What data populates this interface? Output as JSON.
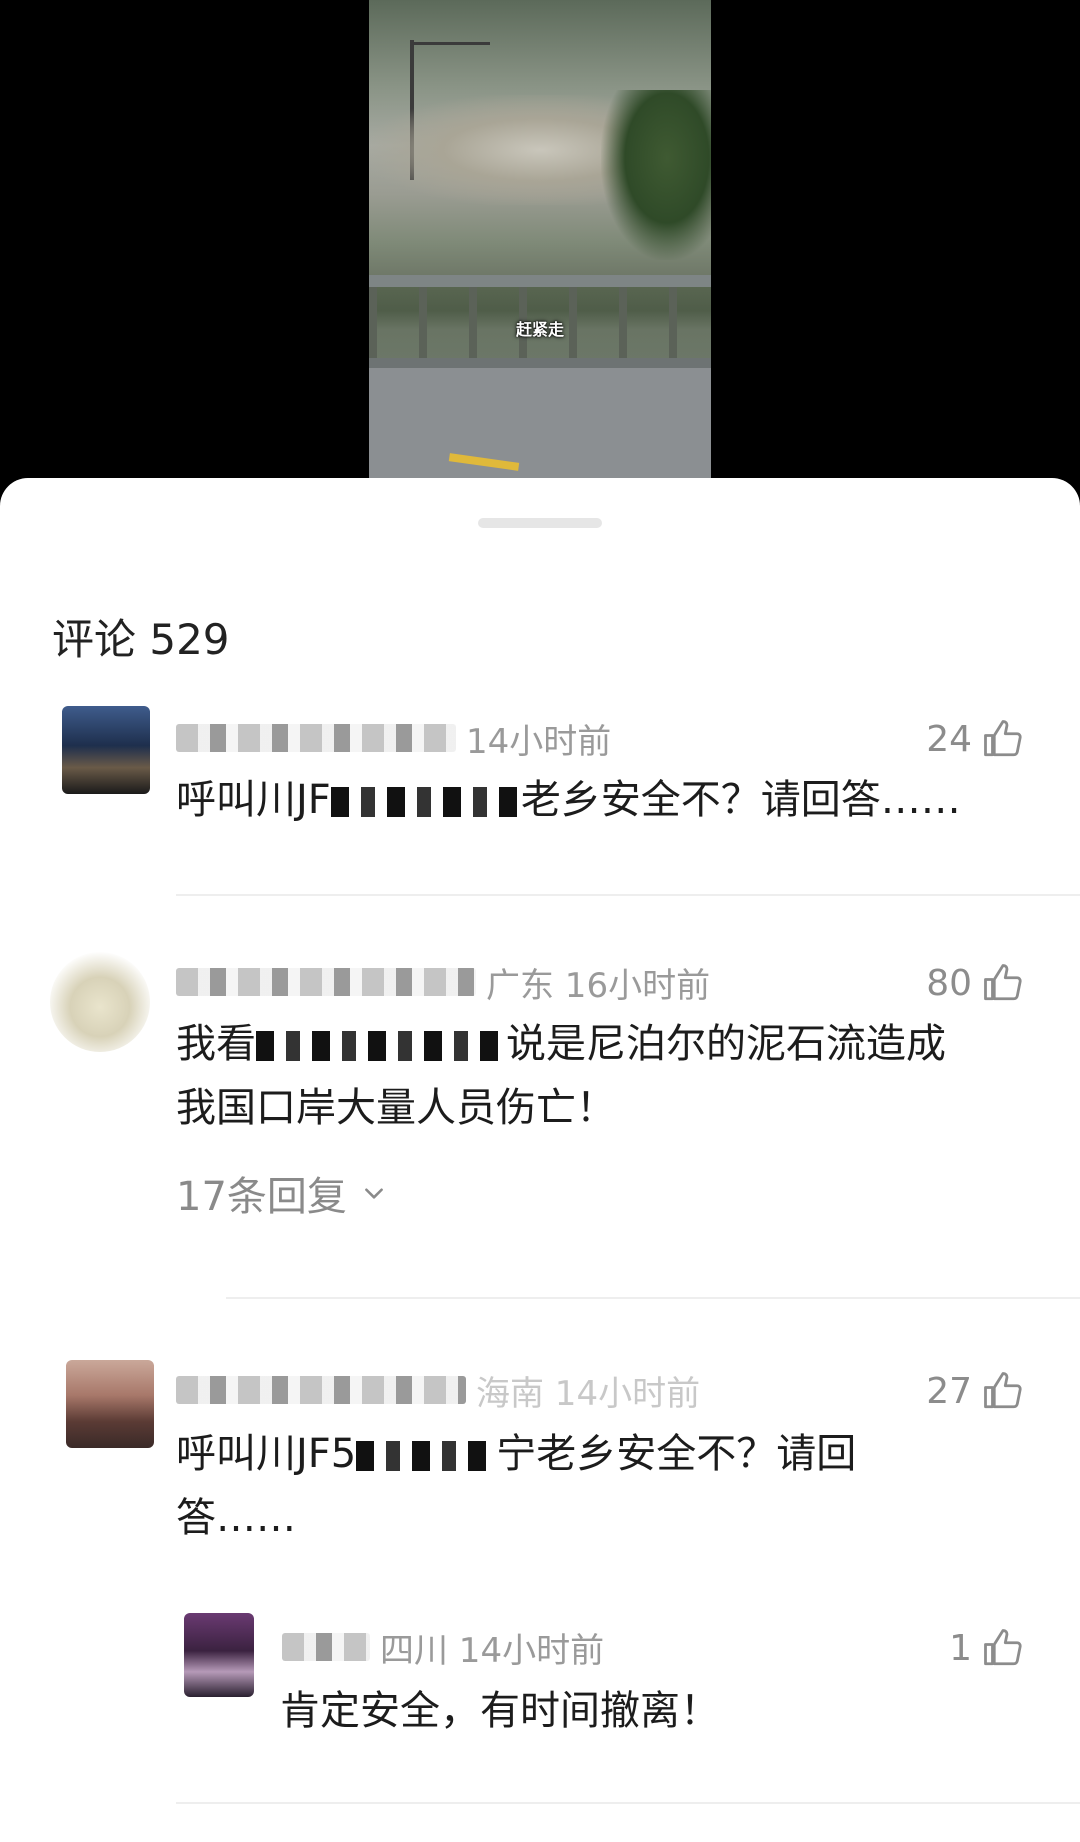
{
  "video": {
    "caption": "赶紧走"
  },
  "comments_header": {
    "title": "评论 529"
  },
  "comments": [
    {
      "meta": "14小时前",
      "likes": "24",
      "text_prefix": "呼叫川JF",
      "text_suffix": "老乡安全不？请回答……"
    },
    {
      "meta": "广东 16小时前",
      "likes": "80",
      "text_prefix": "我看",
      "text_suffix": "说是尼泊尔的泥石流造成",
      "text_line2": "我国口岸大量人员伤亡！",
      "replies": "17条回复"
    },
    {
      "meta": "海南 14小时前",
      "likes": "27",
      "text_prefix": "呼叫川JF5",
      "text_suffix": "宁老乡安全不？请回",
      "text_line2": "答……"
    },
    {
      "meta": "四川 14小时前",
      "likes": "1",
      "text": "肯定安全，有时间撤离！"
    }
  ],
  "icons": {
    "like": "thumbs-up-icon",
    "expand": "chevron-down-icon"
  }
}
